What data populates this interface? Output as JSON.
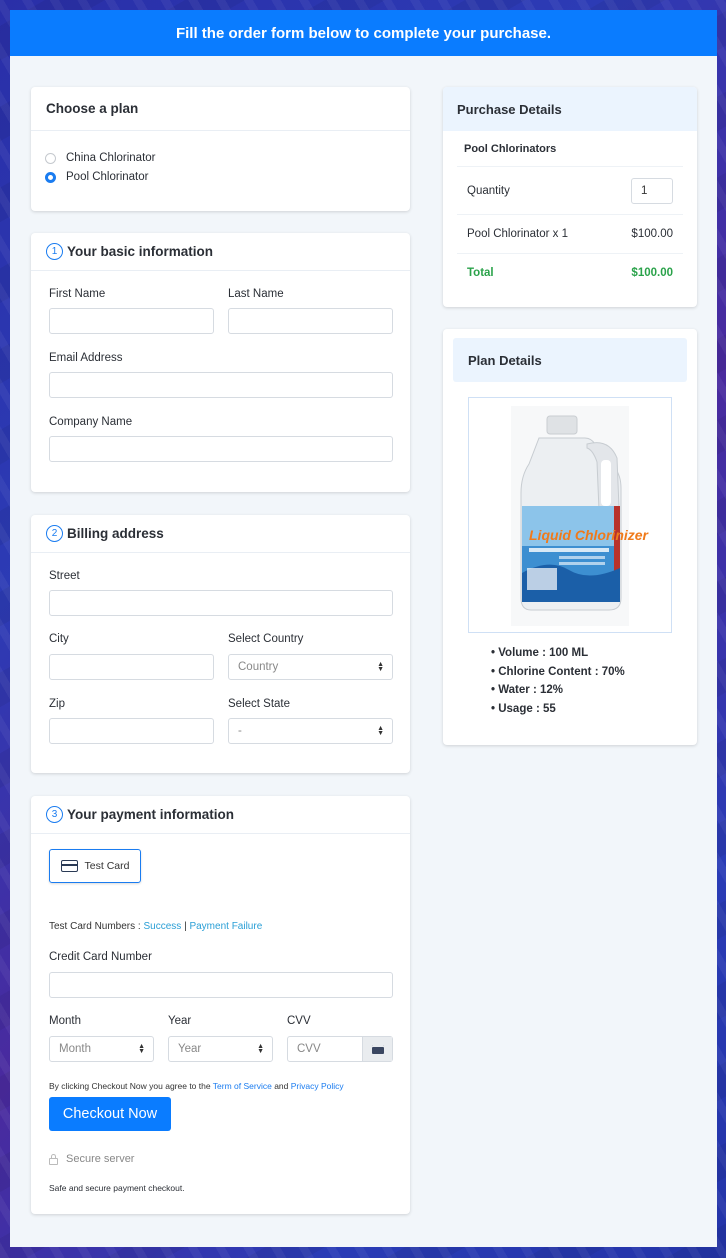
{
  "banner": {
    "title": "Fill the order form below to complete your purchase."
  },
  "plan": {
    "heading": "Choose a plan",
    "options": [
      {
        "label": "China Chlorinator",
        "selected": false
      },
      {
        "label": "Pool Chlorinator",
        "selected": true
      }
    ]
  },
  "basic_info": {
    "step": "1",
    "heading": "Your basic information",
    "first_name_label": "First Name",
    "last_name_label": "Last Name",
    "email_label": "Email Address",
    "company_label": "Company Name"
  },
  "billing": {
    "step": "2",
    "heading": "Billing address",
    "street_label": "Street",
    "city_label": "City",
    "country_label": "Select Country",
    "country_value": "Country",
    "zip_label": "Zip",
    "state_label": "Select State",
    "state_value": "-"
  },
  "payment": {
    "step": "3",
    "heading": "Your payment information",
    "card_option": "Test Card",
    "test_numbers_prefix": "Test Card Numbers : ",
    "success_link": "Success",
    "separator": "|",
    "failure_link": "Payment Failure",
    "cc_label": "Credit Card Number",
    "month_label": "Month",
    "month_value": "Month",
    "year_label": "Year",
    "year_value": "Year",
    "cvv_label": "CVV",
    "cvv_placeholder": "CVV",
    "terms_prefix": "By clicking Checkout Now you agree to the ",
    "terms_link": "Term of Service",
    "terms_and": " and ",
    "privacy_link": "Privacy Policy",
    "checkout_button": "Checkout Now",
    "secure_label": "Secure server",
    "safe_note": "Safe and secure payment checkout."
  },
  "purchase": {
    "heading": "Purchase Details",
    "product_group": "Pool Chlorinators",
    "quantity_label": "Quantity",
    "quantity_value": "1",
    "line_item": "Pool Chlorinator x 1",
    "line_price": "$100.00",
    "total_label": "Total",
    "total_value": "$100.00"
  },
  "plan_details": {
    "heading": "Plan Details",
    "product_image_alt": "Liquid Chlorinizer jug",
    "label_brand": "Liquid Chlorinizer",
    "specs": [
      "Volume : 100 ML",
      "Chlorine Content : 70%",
      "Water : 12%",
      "Usage : 55"
    ]
  },
  "colors": {
    "primary": "#0a7cff",
    "success": "#2aa24a",
    "link": "#2a9fd6",
    "panel_bg": "#f2f6fa"
  }
}
